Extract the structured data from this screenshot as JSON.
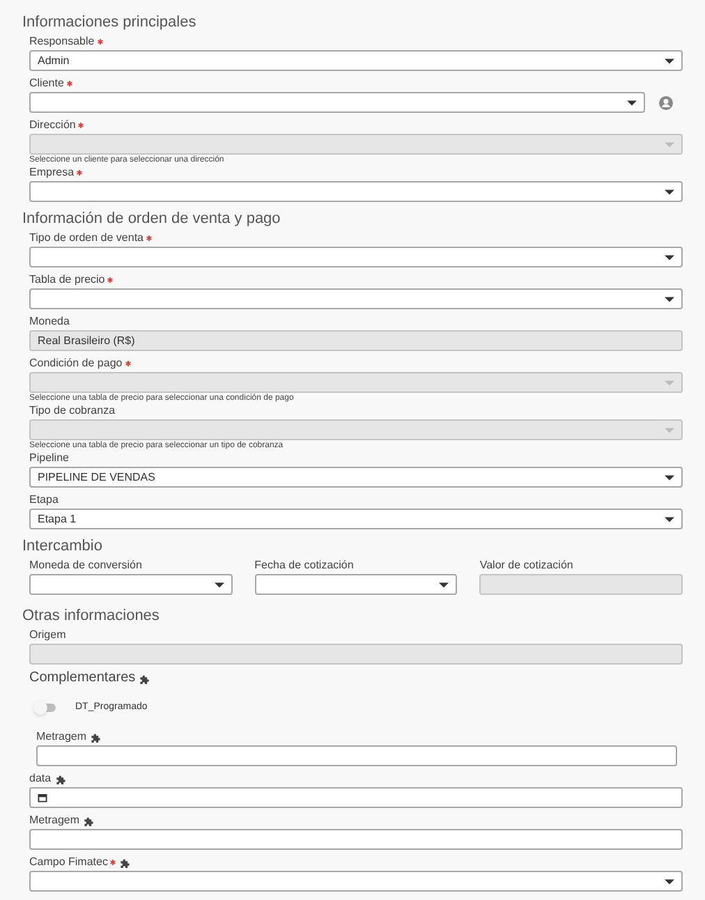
{
  "sections": [
    {
      "title": "Informaciones principales",
      "fields": [
        {
          "kind": "select",
          "label": "Responsable",
          "required": true,
          "value": "Admin",
          "disabled": false
        },
        {
          "kind": "select",
          "label": "Cliente",
          "required": true,
          "disabled": false,
          "contact_button": true
        },
        {
          "kind": "select",
          "label": "Dirección",
          "required": true,
          "disabled": true,
          "hint": "Seleccione un cliente para seleccionar una dirección"
        },
        {
          "kind": "select",
          "label": "Empresa",
          "required": true,
          "disabled": false
        }
      ]
    },
    {
      "title": "Información de orden de venta y pago",
      "fields": [
        {
          "kind": "select",
          "label": "Tipo de orden de venta",
          "required": true,
          "disabled": false
        },
        {
          "kind": "select",
          "label": "Tabla de precio",
          "required": true,
          "disabled": false
        },
        {
          "kind": "text",
          "label": "Moneda",
          "value": "Real Brasileiro (R$)",
          "disabled": true
        },
        {
          "kind": "select",
          "label": "Condición de pago",
          "required": true,
          "disabled": true,
          "hint": "Seleccione una tabla de precio para seleccionar una condición de pago"
        },
        {
          "kind": "select",
          "label": "Tipo de cobranza",
          "disabled": true,
          "hint": "Seleccione una tabla de precio para seleccionar un tipo de cobranza"
        },
        {
          "kind": "select",
          "label": "Pipeline",
          "value": "PIPELINE DE VENDAS",
          "disabled": false
        },
        {
          "kind": "select",
          "label": "Etapa",
          "value": "Etapa 1",
          "disabled": false
        }
      ]
    },
    {
      "title": "Intercambio",
      "fields": [
        {
          "kind": "row",
          "items": [
            {
              "kind": "select",
              "label": "Moneda de conversión",
              "disabled": false
            },
            {
              "kind": "select",
              "label": "Fecha de cotización",
              "disabled": false
            },
            {
              "kind": "text",
              "label": "Valor de cotización",
              "disabled": true
            }
          ]
        }
      ]
    },
    {
      "title": "Otras informaciones",
      "fields": [
        {
          "kind": "text",
          "label": "Origem",
          "disabled": true
        },
        {
          "kind": "heading",
          "label": "Complementares",
          "extension": true
        },
        {
          "kind": "toggle",
          "label": "DT_Programado",
          "on": false
        },
        {
          "kind": "text",
          "label": "Metragem",
          "disabled": false,
          "extension": true,
          "indented": true
        },
        {
          "kind": "date",
          "label": "data",
          "disabled": false,
          "extension": true
        },
        {
          "kind": "text",
          "label": "Metragem",
          "disabled": false,
          "extension": true
        },
        {
          "kind": "select",
          "label": "Campo Fimatec",
          "required": true,
          "disabled": false,
          "extension": true
        }
      ]
    }
  ]
}
